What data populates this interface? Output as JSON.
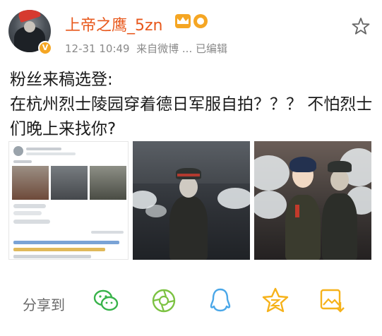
{
  "post": {
    "username": "上帝之鹰_5zn",
    "timestamp": "12-31 10:49",
    "source": "来自微博 ... 已编辑",
    "text_line1": "粉丝来稿选登:",
    "text_line2": "在杭州烈士陵园穿着德日军服自拍？？？ 不怕烈士们晚上来找你?"
  },
  "icons": {
    "verified": "v-badge-icon",
    "vip": "crown-icon",
    "medal": "medal-icon",
    "favorite": "star-outline-icon"
  },
  "share": {
    "label": "分享到",
    "targets": [
      "wechat-icon",
      "moments-icon",
      "qq-icon",
      "qzone-icon",
      "save-image-icon"
    ]
  },
  "colors": {
    "username": "#e8581c",
    "badge": "#f5a623",
    "wechat": "#38b34a",
    "moments": "#7cc242",
    "qq": "#4aa7e8",
    "qzone": "#f6b21a",
    "save": "#f6b21a"
  }
}
